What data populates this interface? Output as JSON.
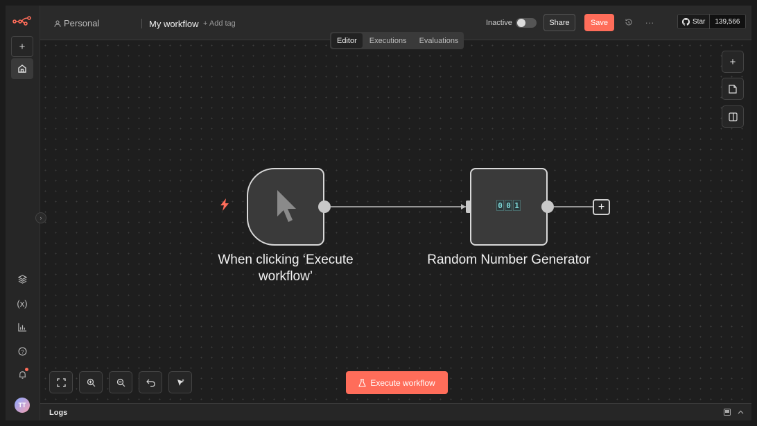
{
  "header": {
    "project": "Personal",
    "workflow_name": "My workflow",
    "add_tag": "+ Add tag",
    "status_label": "Inactive",
    "active": false,
    "share_label": "Share",
    "save_label": "Save",
    "github_star_label": "Star",
    "github_star_count": "139,566"
  },
  "tabs": [
    {
      "label": "Editor",
      "active": true
    },
    {
      "label": "Executions",
      "active": false
    },
    {
      "label": "Evaluations",
      "active": false
    }
  ],
  "nodes": {
    "trigger": {
      "label": "When clicking ‘Execute workflow’",
      "icon": "cursor-icon"
    },
    "rng": {
      "label": "Random Number Generator",
      "digits": [
        "0",
        "0",
        "1"
      ]
    }
  },
  "execute_button": {
    "label": "Execute workflow"
  },
  "logs": {
    "label": "Logs"
  },
  "user": {
    "initials": "TT"
  },
  "colors": {
    "accent": "#ff6d5a",
    "digit": "#7fd8d8"
  }
}
